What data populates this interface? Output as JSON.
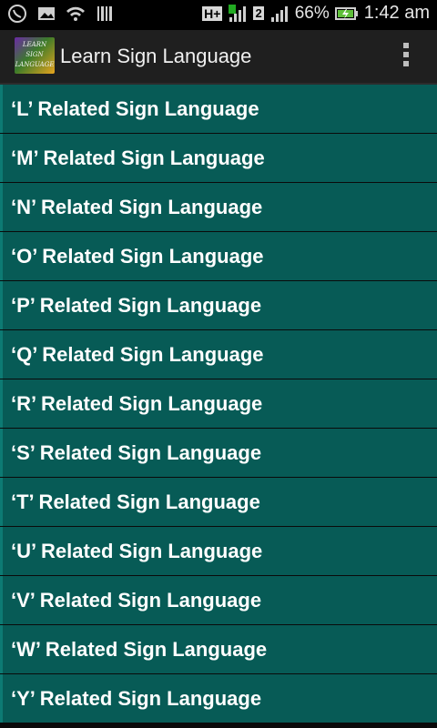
{
  "status_bar": {
    "battery_percent": "66%",
    "time": "1:42 am",
    "network_badge": "H+",
    "sim_badge": "2"
  },
  "action_bar": {
    "logo_text": [
      "LEARN",
      "SIGN",
      "LANGUAGE"
    ],
    "title": "Learn Sign Language"
  },
  "list": {
    "items": [
      "‘L’ Related Sign Language",
      "‘M’ Related Sign Language",
      "‘N’ Related Sign Language",
      "‘O’ Related Sign Language",
      "‘P’ Related Sign Language",
      "‘Q’ Related Sign Language",
      "‘R’ Related Sign Language",
      "‘S’ Related Sign Language",
      "‘T’ Related Sign Language",
      "‘U’ Related Sign Language",
      "‘V’ Related Sign Language",
      "‘W’ Related Sign Language",
      "‘Y’ Related Sign Language"
    ]
  },
  "colors": {
    "list_background": "#075b56",
    "action_bar": "#1f1f1f"
  }
}
